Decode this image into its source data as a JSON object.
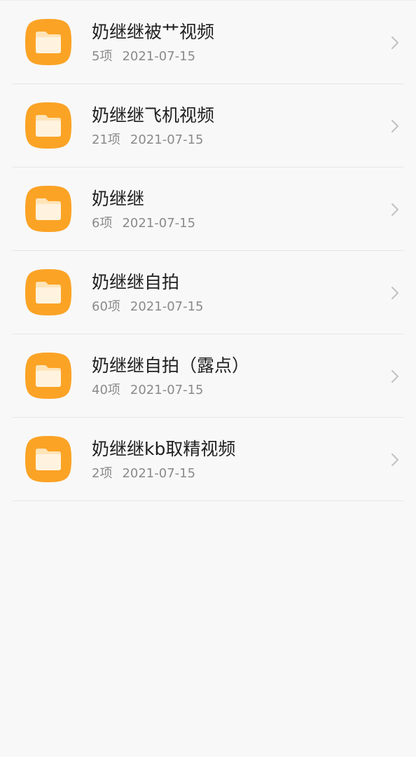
{
  "folders": [
    {
      "name": "奶继继被艹视频",
      "count": "5项",
      "date": "2021-07-15"
    },
    {
      "name": "奶继继飞机视频",
      "count": "21项",
      "date": "2021-07-15"
    },
    {
      "name": "奶继继",
      "count": "6项",
      "date": "2021-07-15"
    },
    {
      "name": "奶继继自拍",
      "count": "60项",
      "date": "2021-07-15"
    },
    {
      "name": "奶继继自拍（露点）",
      "count": "40项",
      "date": "2021-07-15"
    },
    {
      "name": "奶继继kb取精视频",
      "count": "2项",
      "date": "2021-07-15"
    }
  ],
  "icons": {
    "folder": "folder-icon",
    "chevron": "chevron-right-icon"
  },
  "colors": {
    "folder_orange": "#FBA325",
    "folder_paper": "#FFF3DF",
    "title_text": "#1F1F1F",
    "meta_text": "#8A8A8A"
  }
}
